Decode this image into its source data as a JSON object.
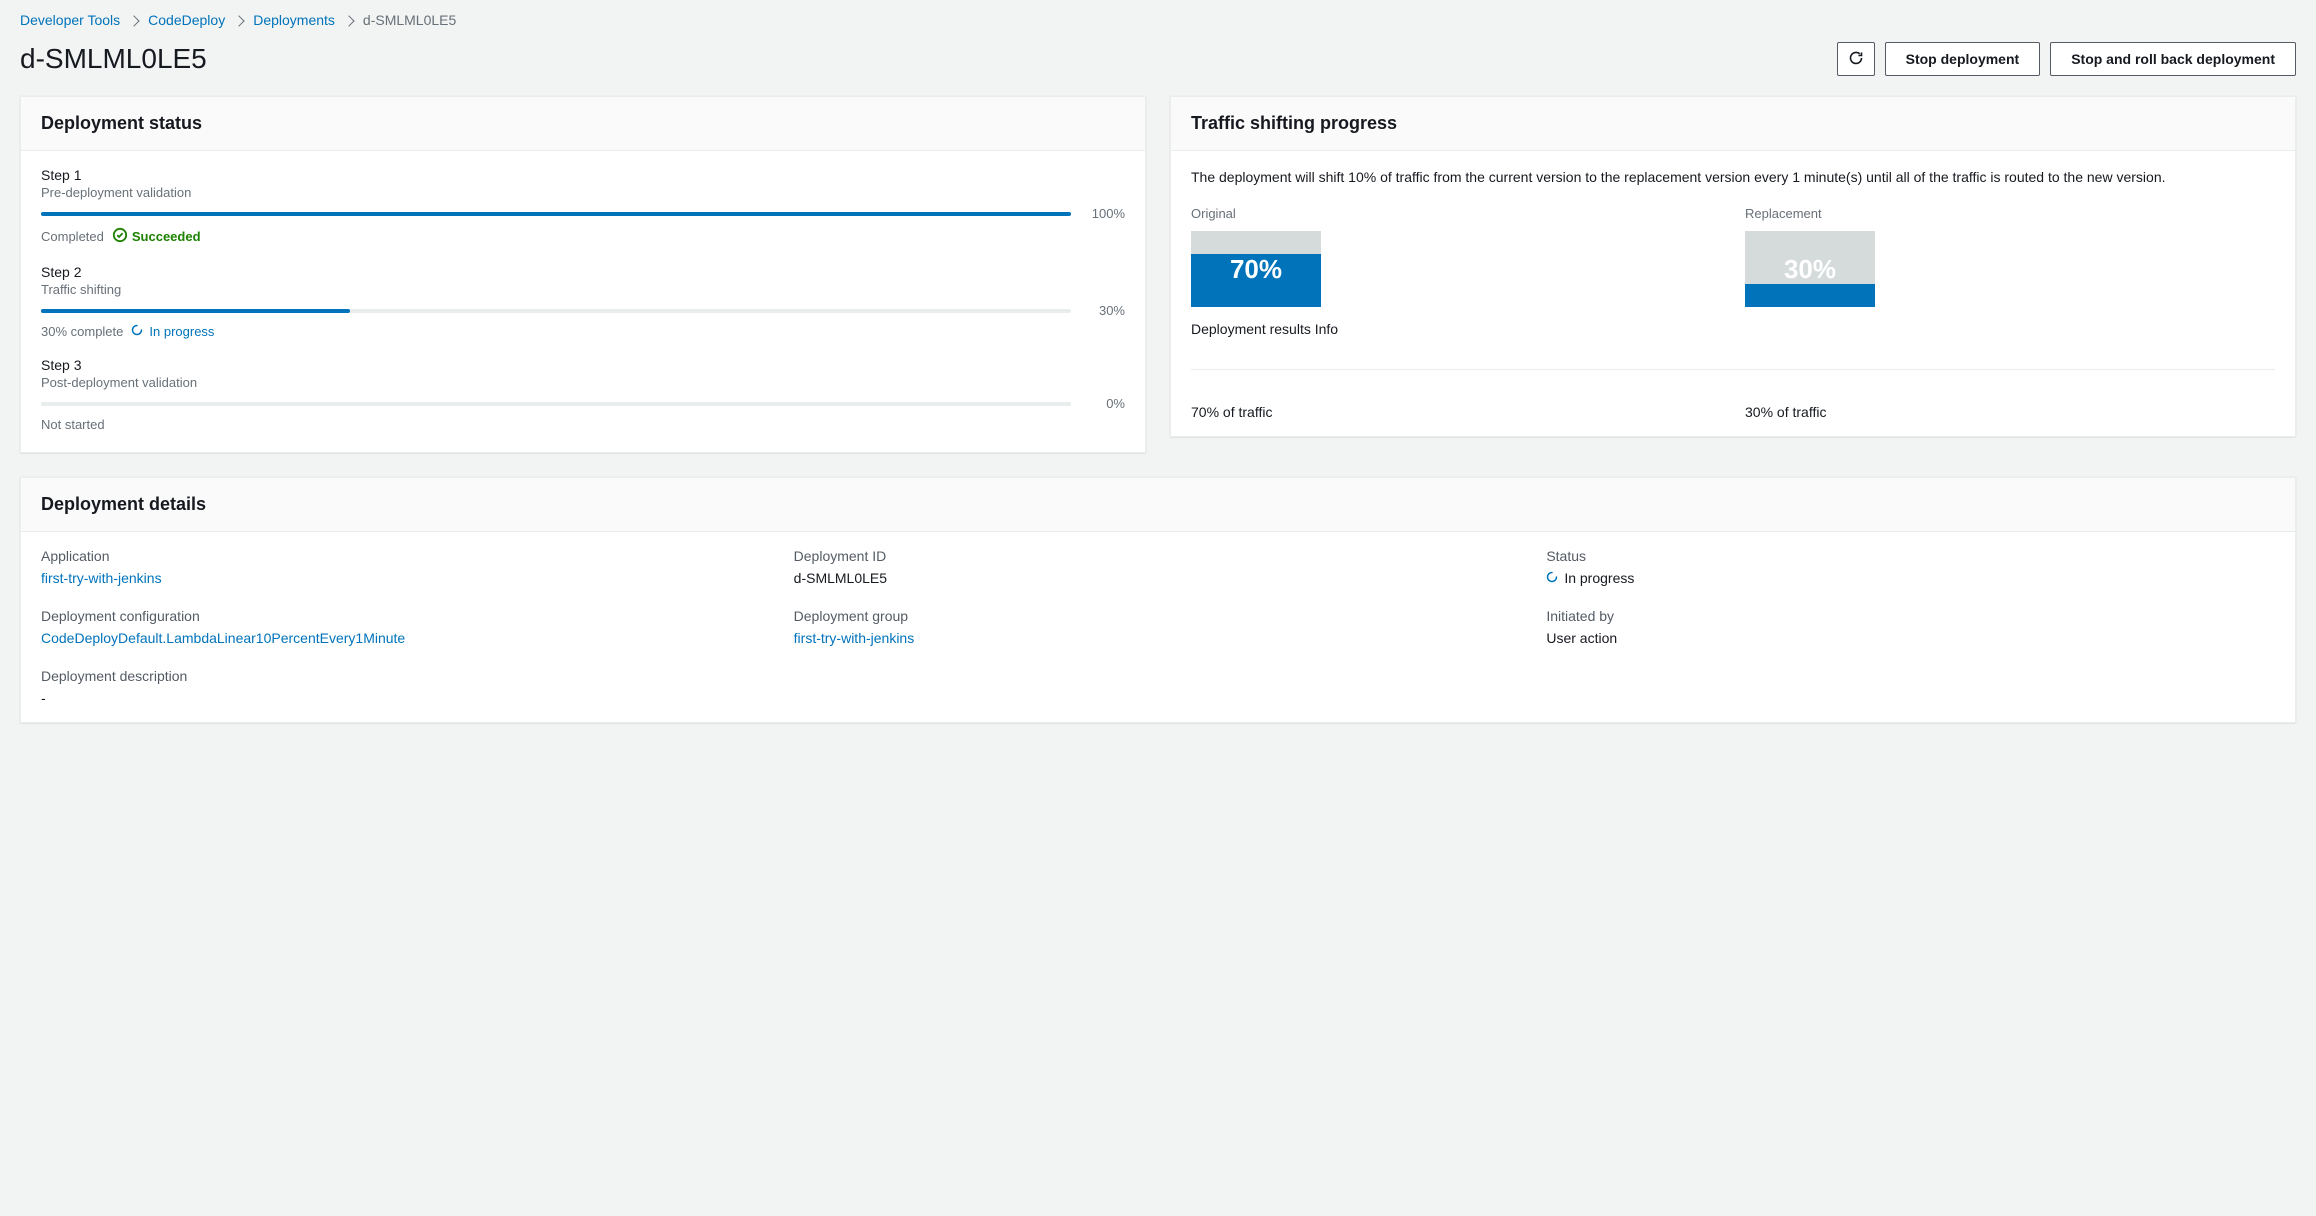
{
  "breadcrumb": {
    "items": [
      {
        "label": "Developer Tools"
      },
      {
        "label": "CodeDeploy"
      },
      {
        "label": "Deployments"
      }
    ],
    "current": "d-SMLML0LE5"
  },
  "header": {
    "title": "d-SMLML0LE5",
    "actions": {
      "stop": "Stop deployment",
      "stop_rollback": "Stop and roll back deployment"
    }
  },
  "deployment_status": {
    "title": "Deployment status",
    "steps": [
      {
        "title": "Step 1",
        "subtitle": "Pre-deployment validation",
        "percent": 100,
        "percent_label": "100%",
        "status_prefix": "Completed",
        "status_text": "Succeeded",
        "status_kind": "success"
      },
      {
        "title": "Step 2",
        "subtitle": "Traffic shifting",
        "percent": 30,
        "percent_label": "30%",
        "status_prefix": "30% complete",
        "status_text": "In progress",
        "status_kind": "inprogress"
      },
      {
        "title": "Step 3",
        "subtitle": "Post-deployment validation",
        "percent": 0,
        "percent_label": "0%",
        "status_prefix": "Not started",
        "status_text": "",
        "status_kind": "none"
      }
    ]
  },
  "traffic": {
    "title": "Traffic shifting progress",
    "description": "The deployment will shift 10% of traffic from the current version to the replacement version every 1 minute(s) until all of the traffic is routed to the new version.",
    "original": {
      "label": "Original",
      "percent": 70,
      "percent_display": "70%",
      "traffic_text": "70% of traffic"
    },
    "replacement": {
      "label": "Replacement",
      "percent": 30,
      "percent_display": "30%",
      "traffic_text": "30% of traffic"
    },
    "results_label": "Deployment results Info"
  },
  "details": {
    "title": "Deployment details",
    "application": {
      "label": "Application",
      "value": "first-try-with-jenkins"
    },
    "deployment_id": {
      "label": "Deployment ID",
      "value": "d-SMLML0LE5"
    },
    "status": {
      "label": "Status",
      "value": "In progress"
    },
    "config": {
      "label": "Deployment configuration",
      "value": "CodeDeployDefault.LambdaLinear10PercentEvery1Minute"
    },
    "group": {
      "label": "Deployment group",
      "value": "first-try-with-jenkins"
    },
    "initiated": {
      "label": "Initiated by",
      "value": "User action"
    },
    "description": {
      "label": "Deployment description",
      "value": "-"
    }
  }
}
